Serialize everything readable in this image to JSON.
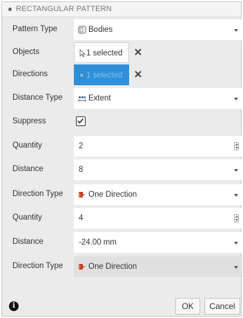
{
  "header": {
    "title": "RECTANGULAR PATTERN"
  },
  "fields": {
    "pattern_type": {
      "label": "Pattern Type",
      "value": "Bodies",
      "icon": "bodies-icon"
    },
    "objects": {
      "label": "Objects",
      "value": "1 selected"
    },
    "directions": {
      "label": "Directions",
      "value": "1 selected"
    },
    "distance_type": {
      "label": "Distance Type",
      "value": "Extent",
      "icon": "extent-icon"
    },
    "suppress": {
      "label": "Suppress",
      "checked": true
    },
    "quantity1": {
      "label": "Quantity",
      "value": "2"
    },
    "distance1": {
      "label": "Distance",
      "value": "8"
    },
    "direction_type1": {
      "label": "Direction Type",
      "value": "One Direction",
      "icon": "one-direction-icon"
    },
    "quantity2": {
      "label": "Quantity",
      "value": "4"
    },
    "distance2": {
      "label": "Distance",
      "value": "-24.00 mm"
    },
    "direction_type2": {
      "label": "Direction Type",
      "value": "One Direction",
      "icon": "one-direction-icon"
    }
  },
  "footer": {
    "ok_label": "OK",
    "cancel_label": "Cancel"
  },
  "colors": {
    "accent": "#2f8fd8",
    "direction_icon": "#c0392b"
  }
}
